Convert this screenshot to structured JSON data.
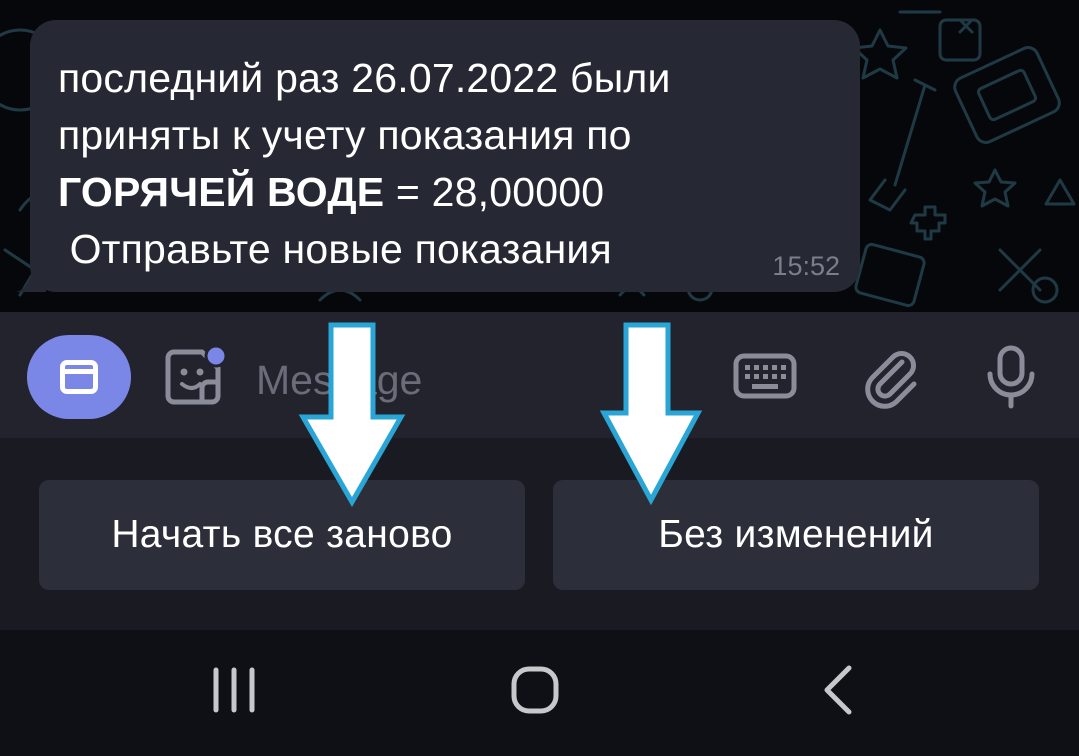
{
  "message": {
    "line1": "последний раз 26.07.2022 были",
    "line2": "приняты к учету показания по",
    "line3_bold": "ГОРЯЧЕЙ ВОДЕ",
    "line3_rest": " = 28,00000",
    "line4": " Отправьте новые показания",
    "time": "15:52"
  },
  "input": {
    "placeholder": "Message"
  },
  "reply_keyboard": {
    "buttons": [
      {
        "label": "Начать все заново"
      },
      {
        "label": "Без изменений"
      }
    ]
  },
  "icons": {
    "keyboard_toggle": "bot-keyboard-icon",
    "sticker": "sticker-icon",
    "keyboard": "keyboard-icon",
    "attach": "paperclip-icon",
    "mic": "microphone-icon",
    "recent_apps": "recent-apps-icon",
    "home": "home-icon",
    "back": "back-icon",
    "annotation": "arrow-down-icon"
  },
  "colors": {
    "accent": "#7a87e6",
    "bubble": "#262834",
    "arrow_outline": "#2aa6d6"
  }
}
